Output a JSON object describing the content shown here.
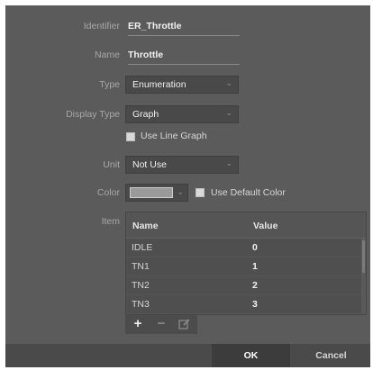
{
  "form": {
    "identifier": {
      "label": "Identifier",
      "value": "ER_Throttle"
    },
    "name": {
      "label": "Name",
      "value": "Throttle"
    },
    "type": {
      "label": "Type",
      "value": "Enumeration"
    },
    "display_type": {
      "label": "Display Type",
      "value": "Graph"
    },
    "use_line_graph": {
      "label": "Use Line Graph",
      "checked": false
    },
    "unit": {
      "label": "Unit",
      "value": "Not Use"
    },
    "color": {
      "label": "Color",
      "swatch": "#9a9a9a"
    },
    "use_default_color": {
      "label": "Use Default Color",
      "checked": false
    },
    "item": {
      "label": "Item"
    }
  },
  "table": {
    "columns": [
      "Name",
      "Value"
    ],
    "rows": [
      {
        "name": "IDLE",
        "value": "0"
      },
      {
        "name": "TN1",
        "value": "1"
      },
      {
        "name": "TN2",
        "value": "2"
      },
      {
        "name": "TN3",
        "value": "3"
      }
    ]
  },
  "toolbar": {
    "add_icon": "plus-icon",
    "remove_icon": "minus-icon",
    "edit_icon": "edit-icon"
  },
  "buttons": {
    "ok": "OK",
    "cancel": "Cancel"
  }
}
